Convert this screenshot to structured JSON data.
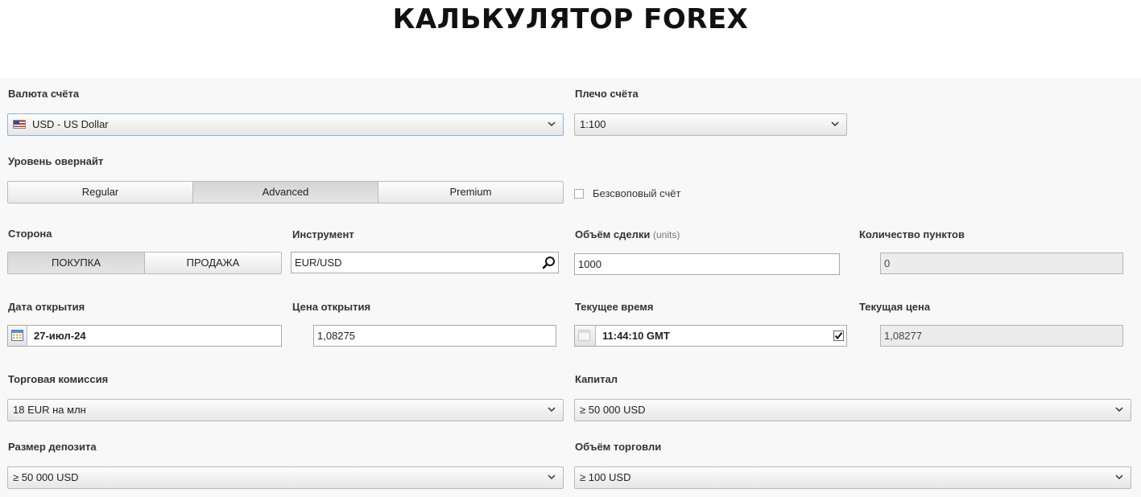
{
  "title": "КАЛЬКУЛЯТОР FOREX",
  "account_currency": {
    "label": "Валюта счёта",
    "value": "USD - US Dollar",
    "flag_icon": "us-flag-icon"
  },
  "leverage": {
    "label": "Плечо счёта",
    "value": "1:100"
  },
  "overnight_level": {
    "label": "Уровень овернайт",
    "options": [
      "Regular",
      "Advanced",
      "Premium"
    ],
    "selected": "Advanced"
  },
  "swap_free": {
    "label": "Безсвоповый счёт",
    "checked": false
  },
  "side": {
    "label": "Сторона",
    "buy_label": "ПОКУПКА",
    "sell_label": "ПРОДАЖА",
    "buy_color": "#28b428",
    "sell_color": "#d8341e"
  },
  "instrument": {
    "label": "Инструмент",
    "value": "EUR/USD"
  },
  "trade_volume": {
    "label": "Объём сделки",
    "unit_hint": "(units)",
    "value": "1000"
  },
  "points_count": {
    "label": "Количество пунктов",
    "value": "0"
  },
  "open_date": {
    "label": "Дата открытия",
    "value": "27-июл-24"
  },
  "open_price": {
    "label": "Цена открытия",
    "value": "1,08275"
  },
  "current_time": {
    "label": "Текущее время",
    "value": "11:44:10 GMT",
    "checked": true
  },
  "current_price": {
    "label": "Текущая цена",
    "value": "1,08277"
  },
  "trade_commission": {
    "label": "Торговая комиссия",
    "value": "18 EUR на млн"
  },
  "capital": {
    "label": "Капитал",
    "value": "≥ 50 000 USD"
  },
  "deposit_size": {
    "label": "Размер депозита",
    "value": "≥ 50 000 USD"
  },
  "trading_volume": {
    "label": "Объём торговли",
    "value": "≥ 100 USD"
  }
}
